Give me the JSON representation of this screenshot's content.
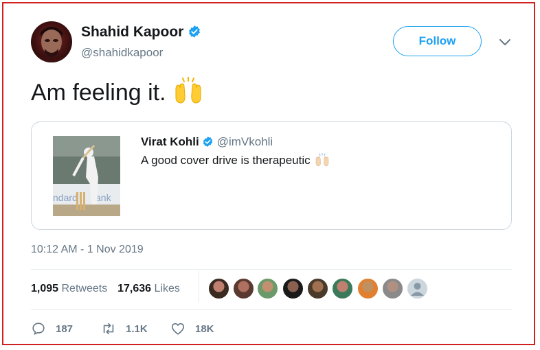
{
  "author": {
    "name": "Shahid Kapoor",
    "handle": "@shahidkapoor",
    "verified": true
  },
  "follow_label": "Follow",
  "tweet_text": "Am feeling it.",
  "tweet_emoji": "raising-hands-emoji",
  "quoted": {
    "name": "Virat Kohli",
    "handle": "@imVkohli",
    "text": "A good cover drive is therapeutic",
    "emoji": "raising-hands-emoji"
  },
  "timestamp": "10:12 AM - 1 Nov 2019",
  "stats": {
    "retweets_count": "1,095",
    "retweets_label": "Retweets",
    "likes_count": "17,636",
    "likes_label": "Likes"
  },
  "actions": {
    "replies": "187",
    "retweets": "1.1K",
    "likes": "18K"
  },
  "colors": {
    "accent": "#1da1f2",
    "frame": "#d0201f",
    "muted": "#657786"
  }
}
